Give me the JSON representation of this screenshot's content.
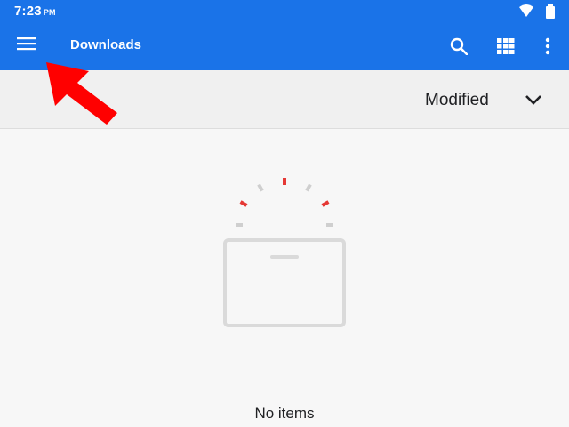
{
  "status_bar": {
    "time": "7:23",
    "ampm": "PM",
    "icons": [
      "wifi-icon",
      "battery-icon"
    ]
  },
  "app_bar": {
    "title": "Downloads",
    "menu_icon": "hamburger-menu-icon",
    "search_icon": "search-icon",
    "grid_icon": "grid-view-icon",
    "more_icon": "more-vert-icon"
  },
  "sort_bar": {
    "label": "Modified",
    "dropdown_icon": "chevron-down-icon"
  },
  "content": {
    "empty_message": "No items"
  },
  "colors": {
    "app_bar": "#1a73e8",
    "background": "#f7f7f7",
    "annotation_arrow": "#ff0000",
    "spinner_active": "#e53935",
    "spinner_inactive": "#cfcfcf"
  }
}
